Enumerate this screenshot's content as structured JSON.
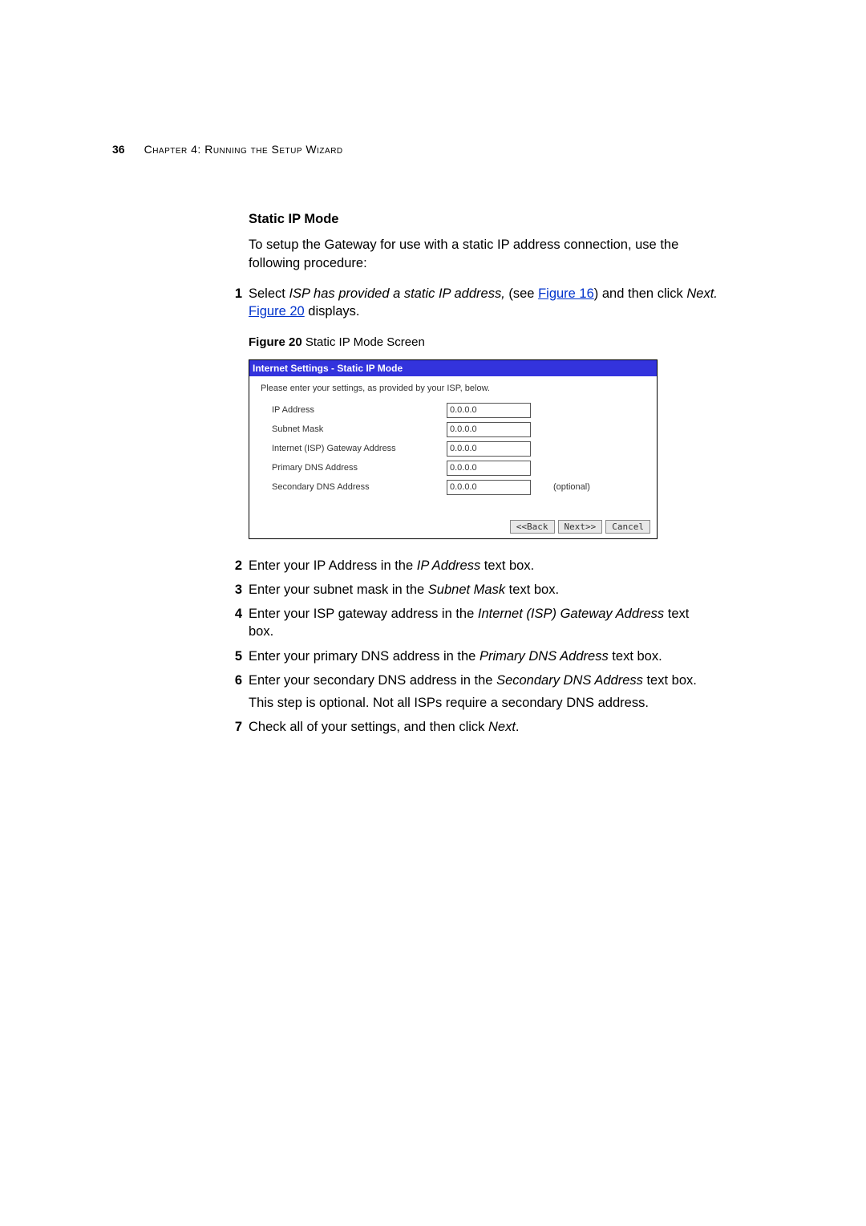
{
  "pageNumber": "36",
  "chapterLabel": "Chapter 4: Running the Setup Wizard",
  "heading": "Static IP Mode",
  "intro": "To setup the Gateway for use with a static IP address connection, use the following procedure:",
  "step1": {
    "prefix": "Select ",
    "italic": "ISP has provided a static IP address,",
    "midA": " (see ",
    "link1": "Figure 16",
    "midB": ") and then click ",
    "nextLabel": "Next.",
    "midC": " ",
    "link2": "Figure 20",
    "suffix": " displays."
  },
  "figCaptionBold": "Figure 20",
  "figCaptionRest": "   Static IP Mode Screen",
  "screenshot": {
    "title": "Internet Settings - Static IP Mode",
    "subtitle": "Please enter your settings, as provided by your ISP, below.",
    "rows": [
      {
        "label": "IP Address",
        "value": "0.0.0.0",
        "optional": ""
      },
      {
        "label": "Subnet Mask",
        "value": "0.0.0.0",
        "optional": ""
      },
      {
        "label": "Internet (ISP) Gateway Address",
        "value": "0.0.0.0",
        "optional": ""
      },
      {
        "label": "Primary DNS Address",
        "value": "0.0.0.0",
        "optional": ""
      },
      {
        "label": "Secondary DNS Address",
        "value": "0.0.0.0",
        "optional": "(optional)"
      }
    ],
    "btnBack": "<<Back",
    "btnNext": "Next>>",
    "btnCancel": "Cancel"
  },
  "step2": {
    "a": "Enter your IP Address in the ",
    "i": "IP Address",
    "b": " text box."
  },
  "step3": {
    "a": "Enter your subnet mask in the ",
    "i": "Subnet Mask",
    "b": " text box."
  },
  "step4": {
    "a": "Enter your ISP gateway address in the ",
    "i": "Internet (ISP) Gateway Address",
    "b": " text box."
  },
  "step5": {
    "a": "Enter your primary DNS address in the ",
    "i": "Primary DNS Address",
    "b": " text box."
  },
  "step6": {
    "a": "Enter your secondary DNS address in the ",
    "i": "Secondary DNS Address",
    "b": " text box.",
    "sub": "This step is optional. Not all ISPs require a secondary DNS address."
  },
  "step7": {
    "a": "Check all of your settings, and then click ",
    "i": "Next",
    "b": "."
  }
}
